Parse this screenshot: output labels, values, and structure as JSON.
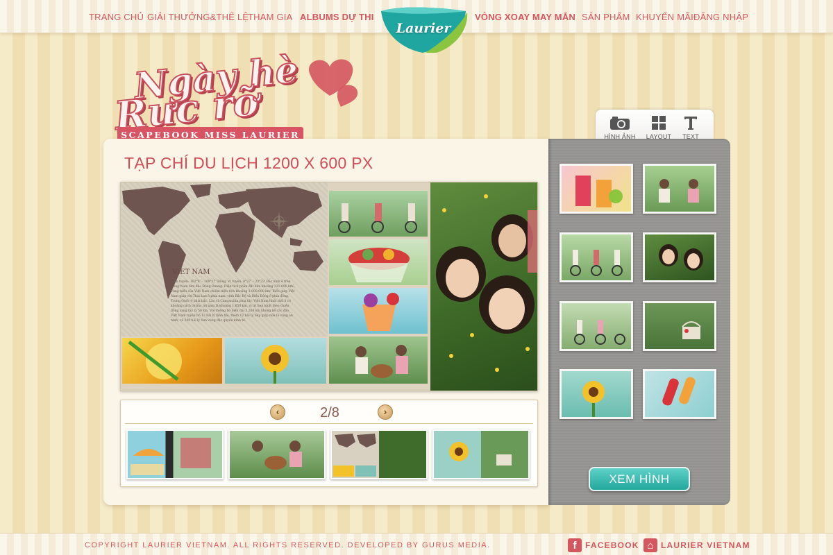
{
  "nav": {
    "left_items": [
      "TRANG CHỦ",
      "GIẢI THƯỞNG&THỂ LỆ",
      "THAM GIA",
      "ALBUMS DỰ THI"
    ],
    "right_items": [
      "VÒNG XOAY MAY MẮN",
      "SẢN PHẨM",
      "KHUYẾN MÃI",
      "ĐĂNG NHẬP"
    ],
    "logo_text": "Laurier"
  },
  "hero": {
    "title_line1": "Ngày hè",
    "title_line2": "Rực rỡ",
    "banner": "SCAPEBOOK MISS LAURIER"
  },
  "main": {
    "title": "TẠP CHÍ DU LỊCH  1200 X 600 PX",
    "map_title": "VIET NAM",
    "map_text": "Kinh tuyến: 102°8' – 109°27' Đông. Vĩ tuyến: 8°27' – 23°23' Bắc nằm ở trên Đông Nam bán đảo Đông Dương. Diện tích phần đất liền khoảng 331.690 km². Vùng biển của Việt Nam chiếm diện tích khoảng 1.000.000 km² Biển giáp Việt Nam giáp với Thái Lan ở phía nam, vịnh Bắc Bộ và Biển Đông ở phía đông, Trung Quốc ở phía bắc, Lào và Campuchia phía tây. Việt Nam hình chữ S có khoảng cách từ bắc tới nam là khoảng 1.650 km, vị trí hẹp nhất theo chiều đông sang tây là 50 km. Với đường bờ biển dài 3.260 km không kể các đảo. Việt Nam tuyên bố 12 hải lý lãnh hải, thêm 12 hải lý tiếp giáp nữa là vùng an ninh, và 200 hải lý làm vùng đặc quyền kinh tế."
  },
  "pager": {
    "count": "2/8",
    "prev_icon": "chevron-left-icon",
    "next_icon": "chevron-right-icon"
  },
  "sidebar": {
    "tabs": [
      {
        "label": "HÌNH ẢNH",
        "icon": "camera-icon"
      },
      {
        "label": "LAYOUT",
        "icon": "layout-grid-icon"
      },
      {
        "label": "TEXT",
        "icon": "text-icon"
      }
    ],
    "button": "XEM HÌNH"
  },
  "footer": {
    "copyright": "COPYRIGHT LAURIER VIETNAM. ALL RIGHTS RESERVED. DEVELOPED BY GURUS MEDIA.",
    "facebook": "FACEBOOK",
    "laurier": "LAURIER VIETNAM"
  },
  "colors": {
    "accent": "#d4575f",
    "teal": "#22a79d",
    "sidebar": "#999896"
  }
}
